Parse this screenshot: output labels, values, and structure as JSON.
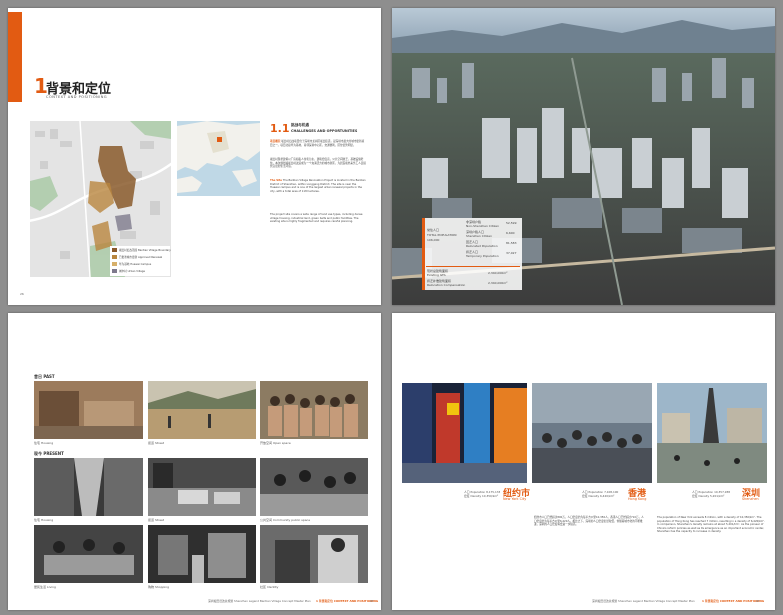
{
  "page1": {
    "section_number": "1",
    "section_title": "背景和定位",
    "section_subtitle": "CONTEXT AND POSITIONING",
    "sub_number": "1.1",
    "sub_title_cn": "挑战与机遇",
    "sub_title_en": "CHALLENGES AND OPPORTUNITIES",
    "para1_lead": "项目概况",
    "para1": "坂田村旧改项目位于深圳市龙岗区坂田街道，是深圳市最大的城市更新项目之一。项目北接华为基地，南邻深圳中心区，交通便利，区位优势明显。",
    "para2": "坂田村现状建筑以厂房和私人住宅为主，建筑密度高，公共空间匮乏，基础设施老化。本次规划将坂田村改造成为一个充满活力的城市新区，为居民和外来务工人员提供宜居的生活环境。",
    "para3_lead": "The Site",
    "para3": "The Bantian Village Renovation Project is located in the Bantian District of Shenzhen, within Longgang District. The site is near the Huawei campus and is one of the largest urban renewal projects in the city, with a total area of 118 hectares.",
    "para4": "The project site covers a wide range of land use types, including dense village housing, industrial land, green belts and public facilities. The existing site is highly fragmented and requires careful planning.",
    "legend": [
      {
        "label": "坂田村旧改范围 Bantian Village Boundary",
        "color": "#8a5a2b"
      },
      {
        "label": "已批准城市更新 Approved Renewal",
        "color": "#b9863f"
      },
      {
        "label": "华为基地 Huawei Campus",
        "color": "#d7b06a"
      },
      {
        "label": "城中村 Urban Village",
        "color": "#7e7a8c"
      }
    ],
    "page_number": "26"
  },
  "page2": {
    "stats": [
      {
        "cn": "常住人口",
        "en": "Total Population",
        "value": "",
        "rows": [
          "非深圳户籍",
          "Non-Shenzhen Citizen",
          "深圳户籍人口",
          "Shenzhen Citizen",
          "回迁人口",
          "Relocated Population",
          "拆迁人口",
          "Temporary Population"
        ],
        "values": [
          "52,599",
          "6,600",
          "81,583",
          "37,027"
        ]
      }
    ],
    "stat_label1": "常住人口",
    "stat_label1_en": "TOTAL POPULATION",
    "stat_label1_value": "106,000",
    "stat_label2": "现状总建筑面积",
    "stat_label2_en": "Existing GFA",
    "stat_label2_value": "2,340,000m²",
    "stat_label3": "拆迁补偿建筑面积",
    "stat_label3_en": "Relocation Compensation",
    "stat_label3_value": "2,340,000m²"
  },
  "page3": {
    "past_label": "昔日 PAST",
    "present_label": "现今 PRESENT",
    "captions_past": [
      "住宅 Housing",
      "街道 Street",
      "开放空间 Open space"
    ],
    "captions_present": [
      "住宅 Housing",
      "街道 Street",
      "公共空间 Community public space",
      "居民生活 Living",
      "购物 Shopping",
      "社区 Identity"
    ],
    "footer": "深圳坂田旧改总规划 Shenzhen Legend Bantian Village Concept Master Plan",
    "footer_section": "1 背景和定位 CONTEXT AND POSITIONING",
    "page_number": "27"
  },
  "page4": {
    "cities": [
      {
        "cn": "纽约市",
        "en": "New York City",
        "pop": "人口 Population 8,175,133",
        "density": "密度 Density 10,350/km²"
      },
      {
        "cn": "香港",
        "en": "Hong Kong",
        "pop": "人口 Population 7,108,100",
        "density": "密度 Density 6,420/km²"
      },
      {
        "cn": "深圳",
        "en": "Shenzhen",
        "pop": "人口 Population 10,357,938",
        "density": "密度 Density 5,201/km²"
      }
    ],
    "note_cn": "纽约市人口已经超过800万，人口密度约为每平方公里10,350人。香港人口已经超过710万，人口密度约为每平方公里6,420人。相比之下，深圳的人口密度仍然较低，但随着城市化的不断推进，深圳的人口密度将会进一步提高。",
    "note_en": "The population of New York exceeds 8 million, with a density of 10,350/km². The population of Hong Kong has reached 7 million, resulting in a density of 6,420/km². In comparison, Shenzhen's density remains at about 5,201/km². As the pioneer of China's reform policies as well as its emergence as an important economic center, Shenzhen has the capacity to increase in density.",
    "footer": "深圳坂田旧改总规划 Shenzhen Legend Bantian Village Concept Master Plan",
    "footer_section": "1 背景和定位 CONTEXT AND POSITIONING",
    "page_number": "27"
  }
}
